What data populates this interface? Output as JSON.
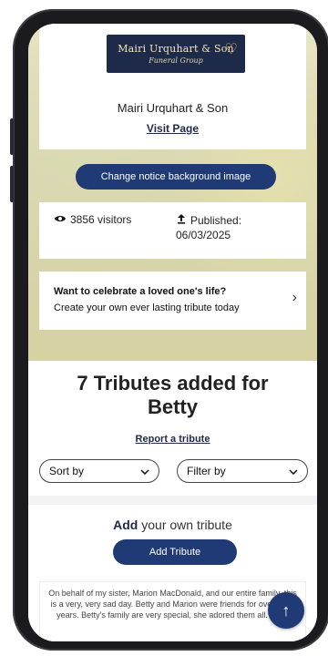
{
  "header": {
    "logo_title": "Mairi Urquhart & Son",
    "logo_subtitle": "Funeral Group",
    "org_name": "Mairi Urquhart & Son",
    "visit_label": "Visit Page",
    "change_bg_label": "Change notice background image"
  },
  "stats": {
    "visitors": "3856 visitors",
    "published_label": "Published:",
    "published_date": "06/03/2025"
  },
  "promo": {
    "title": "Want to celebrate a loved one's life?",
    "subtitle": "Create your own ever lasting tribute today"
  },
  "tributes": {
    "heading_line1": "7 Tributes added for",
    "heading_line2": "Betty",
    "report_label": "Report a tribute",
    "sort_label": "Sort by",
    "filter_label": "Filter by",
    "add_strong": "Add",
    "add_rest": " your own tribute",
    "add_button": "Add Tribute",
    "sample_text": "On behalf of my sister, Marion MacDonald, and our entire family, this is a very, very sad day. Betty and Marion were friends for over thirty years. Betty's family are very special, she adored them all. Betty"
  },
  "colors": {
    "accent": "#1f3a75",
    "phone": "#1b1b1f"
  },
  "icons": {
    "visitors": "eye-icon",
    "published": "upload-icon",
    "promo": "chevron-right-icon",
    "dropdown": "chevron-down-icon",
    "scroll": "arrow-up-icon"
  }
}
